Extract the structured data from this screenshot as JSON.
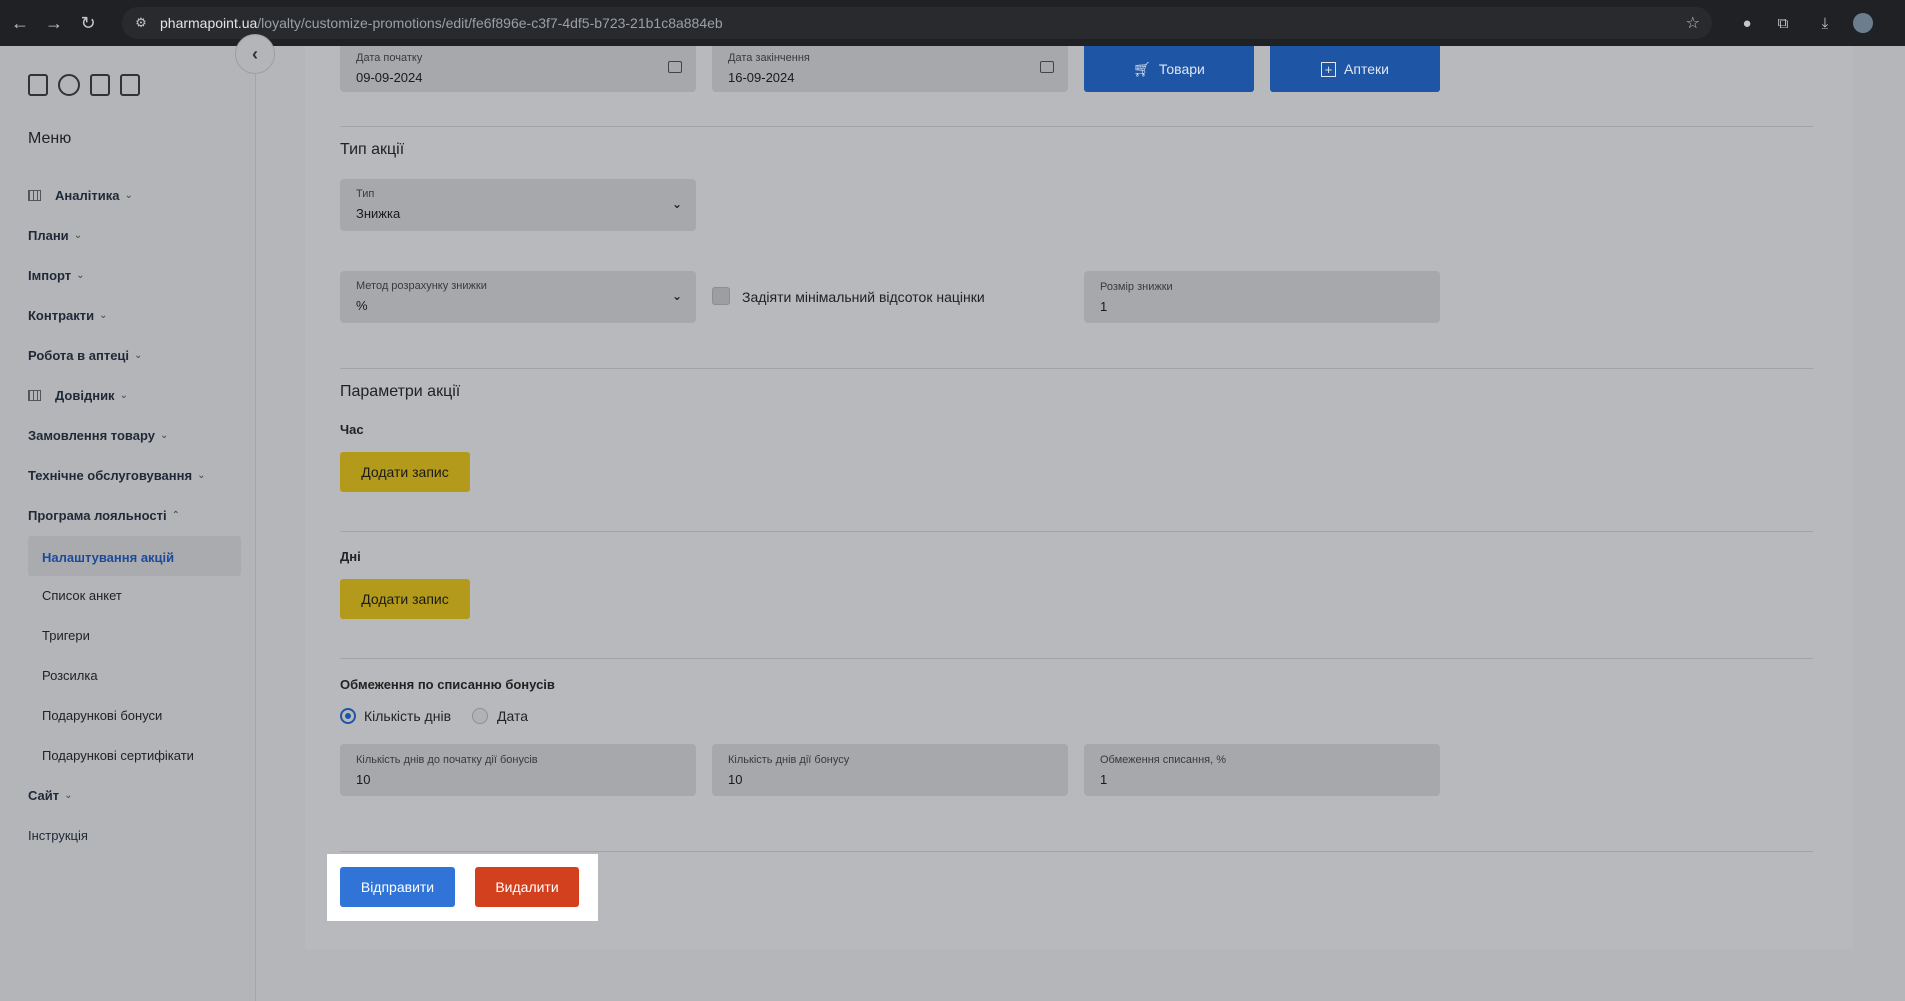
{
  "browser": {
    "url_host": "pharmapoint.ua",
    "url_path": "/loyalty/customize-promotions/edit/fe6f896e-c3f7-4df5-b723-21b1c8a884eb"
  },
  "sidebar": {
    "menu_title": "Меню",
    "items": [
      {
        "label": "Аналітика"
      },
      {
        "label": "Плани"
      },
      {
        "label": "Імпорт"
      },
      {
        "label": "Контракти"
      },
      {
        "label": "Робота в аптеці"
      },
      {
        "label": "Довідник"
      },
      {
        "label": "Замовлення товару"
      },
      {
        "label": "Технічне обслуговування"
      },
      {
        "label": "Програма лояльності"
      },
      {
        "label": "Сайт"
      },
      {
        "label": "Інструкція"
      }
    ],
    "subitems": [
      {
        "label": "Налаштування акцій"
      },
      {
        "label": "Список анкет"
      },
      {
        "label": "Тригери"
      },
      {
        "label": "Розсилка"
      },
      {
        "label": "Подарункові бонуси"
      },
      {
        "label": "Подарункові сертифікати"
      }
    ]
  },
  "form": {
    "start_date": {
      "label": "Дата початку",
      "value": "09-09-2024"
    },
    "end_date": {
      "label": "Дата закінчення",
      "value": "16-09-2024"
    },
    "goods_button": "Товари",
    "pharmacies_button": "Аптеки",
    "promo_type_title": "Тип акції",
    "type": {
      "label": "Тип",
      "value": "Знижка"
    },
    "discount_method": {
      "label": "Метод розрахунку знижки",
      "value": "%"
    },
    "min_margin_label": "Задіяти мінімальний відсоток націнки",
    "discount_size": {
      "label": "Розмір знижки",
      "value": "1"
    },
    "params_title": "Параметри акції",
    "time_title": "Час",
    "add_record_label": "Додати запис",
    "days_title": "Дні",
    "bonus_limit_title": "Обмеження по списанню бонусів",
    "radio_days_label": "Кількість днів",
    "radio_date_label": "Дата",
    "days_before_start": {
      "label": "Кількість днів до початку дії бонусів",
      "value": "10"
    },
    "days_bonus_active": {
      "label": "Кількість днів дії бонусу",
      "value": "10"
    },
    "write_off_limit": {
      "label": "Обмеження списання, %",
      "value": "1"
    },
    "submit_label": "Відправити",
    "delete_label": "Видалити"
  }
}
